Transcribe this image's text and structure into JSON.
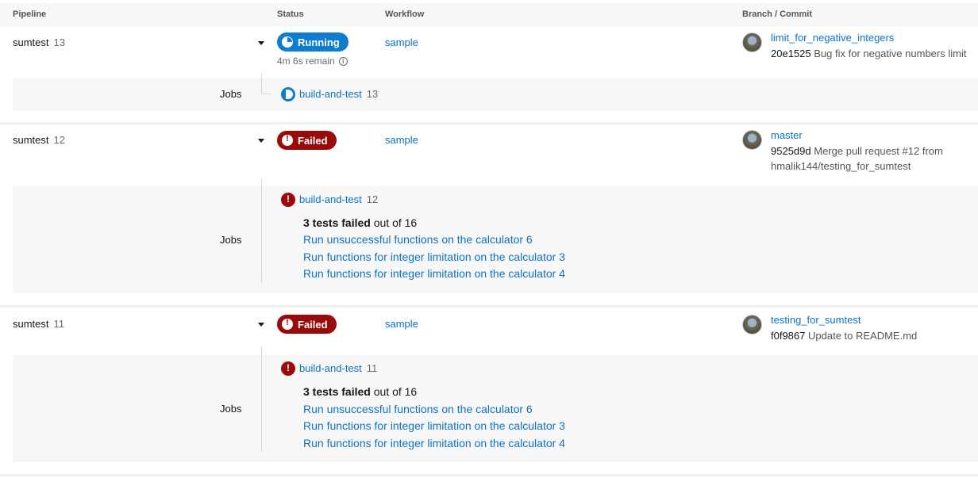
{
  "header": {
    "pipeline": "Pipeline",
    "status": "Status",
    "workflow": "Workflow",
    "branch_commit": "Branch / Commit"
  },
  "pipelines": [
    {
      "name": "sumtest",
      "number": "13",
      "status": "Running",
      "remain": "4m 6s remain",
      "workflow": "sample",
      "branch": "limit_for_negative_integers",
      "sha": "20e1525",
      "message": "Bug fix for negative numbers limit",
      "jobs_label": "Jobs",
      "job": {
        "name": "build-and-test",
        "number": "13",
        "status": "running"
      }
    },
    {
      "name": "sumtest",
      "number": "12",
      "status": "Failed",
      "workflow": "sample",
      "branch": "master",
      "sha": "9525d9d",
      "message": "Merge pull request #12 from hmalik144/testing_for_sumtest",
      "jobs_label": "Jobs",
      "job": {
        "name": "build-and-test",
        "number": "12",
        "status": "failed"
      },
      "failed_count": "3 tests failed",
      "failed_suffix": "out of 16",
      "failed_tests": [
        "Run unsuccessful functions on the calculator 6",
        "Run functions for integer limitation on the calculator 3",
        "Run functions for integer limitation on the calculator 4"
      ]
    },
    {
      "name": "sumtest",
      "number": "11",
      "status": "Failed",
      "workflow": "sample",
      "branch": "testing_for_sumtest",
      "sha": "f0f9867",
      "message": "Update to README.md",
      "jobs_label": "Jobs",
      "job": {
        "name": "build-and-test",
        "number": "11",
        "status": "failed"
      },
      "failed_count": "3 tests failed",
      "failed_suffix": "out of 16",
      "failed_tests": [
        "Run unsuccessful functions on the calculator 6",
        "Run functions for integer limitation on the calculator 3",
        "Run functions for integer limitation on the calculator 4"
      ]
    }
  ],
  "colors": {
    "running": "#0e7ccf",
    "failed": "#9b0a0a",
    "link": "#0e73c2"
  }
}
